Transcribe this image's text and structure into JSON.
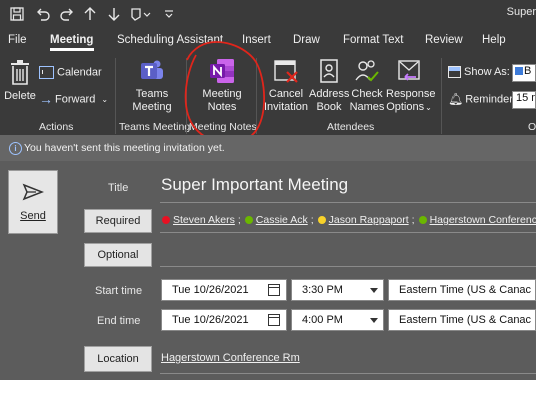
{
  "window": {
    "title_partial": "Super"
  },
  "menu": [
    "File",
    "Meeting",
    "Scheduling Assistant",
    "Insert",
    "Draw",
    "Format Text",
    "Review",
    "Help"
  ],
  "ribbon": {
    "delete": "Delete",
    "calendar": "Calendar",
    "forward": "Forward",
    "actions_group": "Actions",
    "teams_line1": "Teams",
    "teams_line2": "Meeting",
    "teams_group": "Teams Meeting",
    "notes_line1": "Meeting",
    "notes_line2": "Notes",
    "notes_group": "Meeting Notes",
    "cancel_line1": "Cancel",
    "cancel_line2": "Invitation",
    "address_line1": "Address",
    "address_line2": "Book",
    "check_line1": "Check",
    "check_line2": "Names",
    "response_line1": "Response",
    "response_line2": "Options",
    "attendees_group": "Attendees",
    "show_as": "Show As:",
    "show_as_value": "B",
    "reminder": "Reminder:",
    "reminder_value": "15 m",
    "options_group_partial": "O"
  },
  "info_message": "You haven't sent this meeting invitation yet.",
  "form": {
    "send": "Send",
    "title_label": "Title",
    "title_value": "Super Important Meeting",
    "required_label": "Required",
    "optional_label": "Optional",
    "start_label": "Start time",
    "end_label": "End time",
    "location_label": "Location",
    "start_date": "Tue 10/26/2021",
    "start_time": "3:30 PM",
    "end_date": "Tue 10/26/2021",
    "end_time": "4:00 PM",
    "timezone": "Eastern Time (US & Canac",
    "location_value": "Hagerstown Conference Rm"
  },
  "attendees": [
    {
      "name": "Steven Akers",
      "status_color": "#e81123"
    },
    {
      "name": "Cassie Ack",
      "status_color": "#6bb700"
    },
    {
      "name": "Jason Rappaport",
      "status_color": "#f8d22a"
    },
    {
      "name": "Hagerstown Conference Rm",
      "status_color": "#6bb700"
    }
  ],
  "colors": {
    "annotation": "#e0251b",
    "onenote": "#7719aa",
    "teams": "#5b5fc7"
  }
}
